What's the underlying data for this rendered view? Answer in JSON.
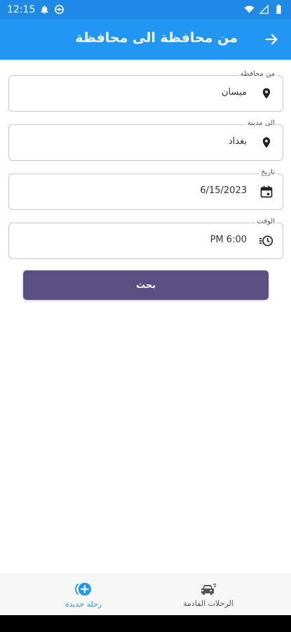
{
  "status_bar": {
    "time": "12:15",
    "icons": [
      "bell-icon",
      "at-sign-icon",
      "wifi-icon",
      "signal-icon",
      "battery-icon"
    ]
  },
  "app_bar": {
    "title": "من محافظة الى محافظة",
    "back_icon": "arrow-right-icon",
    "color": "#2196f3"
  },
  "form": {
    "from_province": {
      "label": "من محافظة",
      "value": "ميسان",
      "icon": "location-pin-icon"
    },
    "to_city": {
      "label": "الى مدينة",
      "value": "بغداد",
      "icon": "location-pin-icon"
    },
    "date": {
      "label": "تاريخ",
      "value": "6/15/2023",
      "icon": "calendar-icon"
    },
    "time": {
      "label": "الوقت",
      "value": "PM 6:00",
      "icon": "clock-icon"
    }
  },
  "search_button": {
    "label": "بحث",
    "color": "#5b5083"
  },
  "bottom_nav": {
    "items": [
      {
        "label": "رحلة جديدة",
        "icon": "add-circle-icon",
        "active": true
      },
      {
        "label": "الرحلات القادمة",
        "icon": "car-icon",
        "active": false
      }
    ]
  }
}
